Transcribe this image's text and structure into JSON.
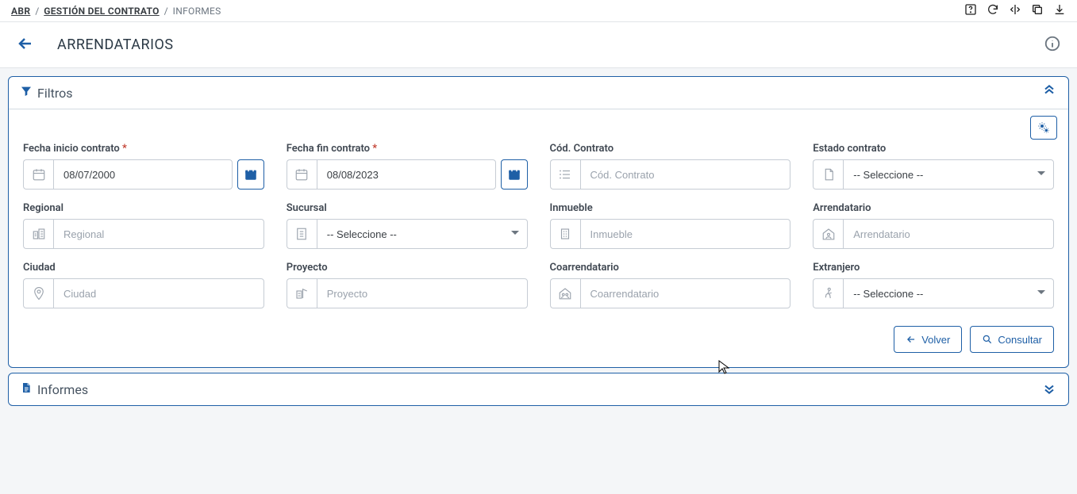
{
  "breadcrumb": {
    "a": "ABR",
    "b": "GESTIÓN DEL CONTRATO",
    "c": "INFORMES"
  },
  "page": {
    "title": "ARRENDATARIOS"
  },
  "filters": {
    "panel_title": "Filtros",
    "fecha_inicio": {
      "label": "Fecha inicio contrato",
      "value": "08/07/2000"
    },
    "fecha_fin": {
      "label": "Fecha fin contrato",
      "value": "08/08/2023"
    },
    "cod_contrato": {
      "label": "Cód. Contrato",
      "placeholder": "Cód. Contrato"
    },
    "estado": {
      "label": "Estado contrato",
      "value": "-- Seleccione --"
    },
    "regional": {
      "label": "Regional",
      "placeholder": "Regional"
    },
    "sucursal": {
      "label": "Sucursal",
      "value": "-- Seleccione --"
    },
    "inmueble": {
      "label": "Inmueble",
      "placeholder": "Inmueble"
    },
    "arrendatario": {
      "label": "Arrendatario",
      "placeholder": "Arrendatario"
    },
    "ciudad": {
      "label": "Ciudad",
      "placeholder": "Ciudad"
    },
    "proyecto": {
      "label": "Proyecto",
      "placeholder": "Proyecto"
    },
    "coarrendatario": {
      "label": "Coarrendatario",
      "placeholder": "Coarrendatario"
    },
    "extranjero": {
      "label": "Extranjero",
      "value": "-- Seleccione --"
    }
  },
  "actions": {
    "volver": "Volver",
    "consultar": "Consultar"
  },
  "informes": {
    "panel_title": "Informes"
  }
}
